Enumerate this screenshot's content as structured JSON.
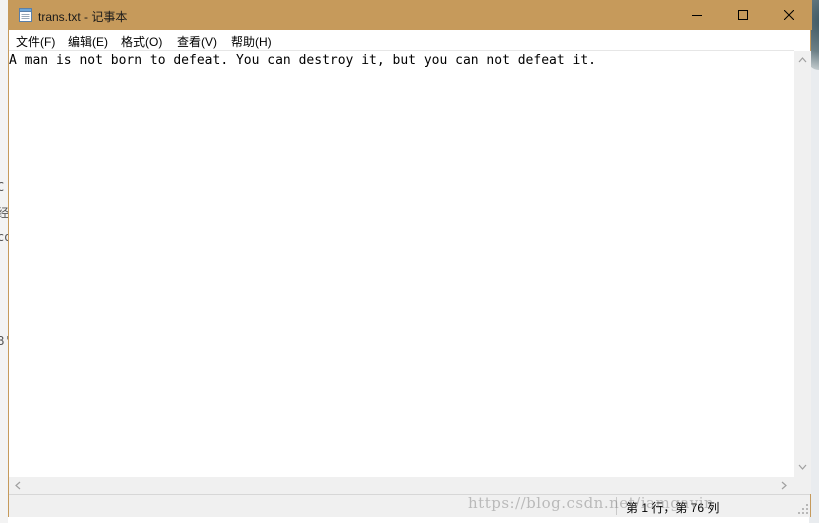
{
  "window": {
    "title": "trans.txt - 记事本",
    "title_icon": "notepad-icon",
    "controls": {
      "minimize_icon": "minimize-icon",
      "maximize_icon": "maximize-icon",
      "close_icon": "close-icon"
    },
    "accent_color": "#c69a5b"
  },
  "menu": {
    "items": [
      {
        "label": "文件(F)"
      },
      {
        "label": "编辑(E)"
      },
      {
        "label": "格式(O)"
      },
      {
        "label": "查看(V)"
      },
      {
        "label": "帮助(H)"
      }
    ]
  },
  "editor": {
    "content": "A man is not born to defeat. You can destroy it, but you can not defeat it."
  },
  "status": {
    "position": "第 1 行，第 76 列"
  },
  "background": {
    "fragments": [
      "C",
      "经",
      "co",
      "B'"
    ]
  },
  "watermark": {
    "text": "https://blog.csdn.net/iamgavin"
  }
}
